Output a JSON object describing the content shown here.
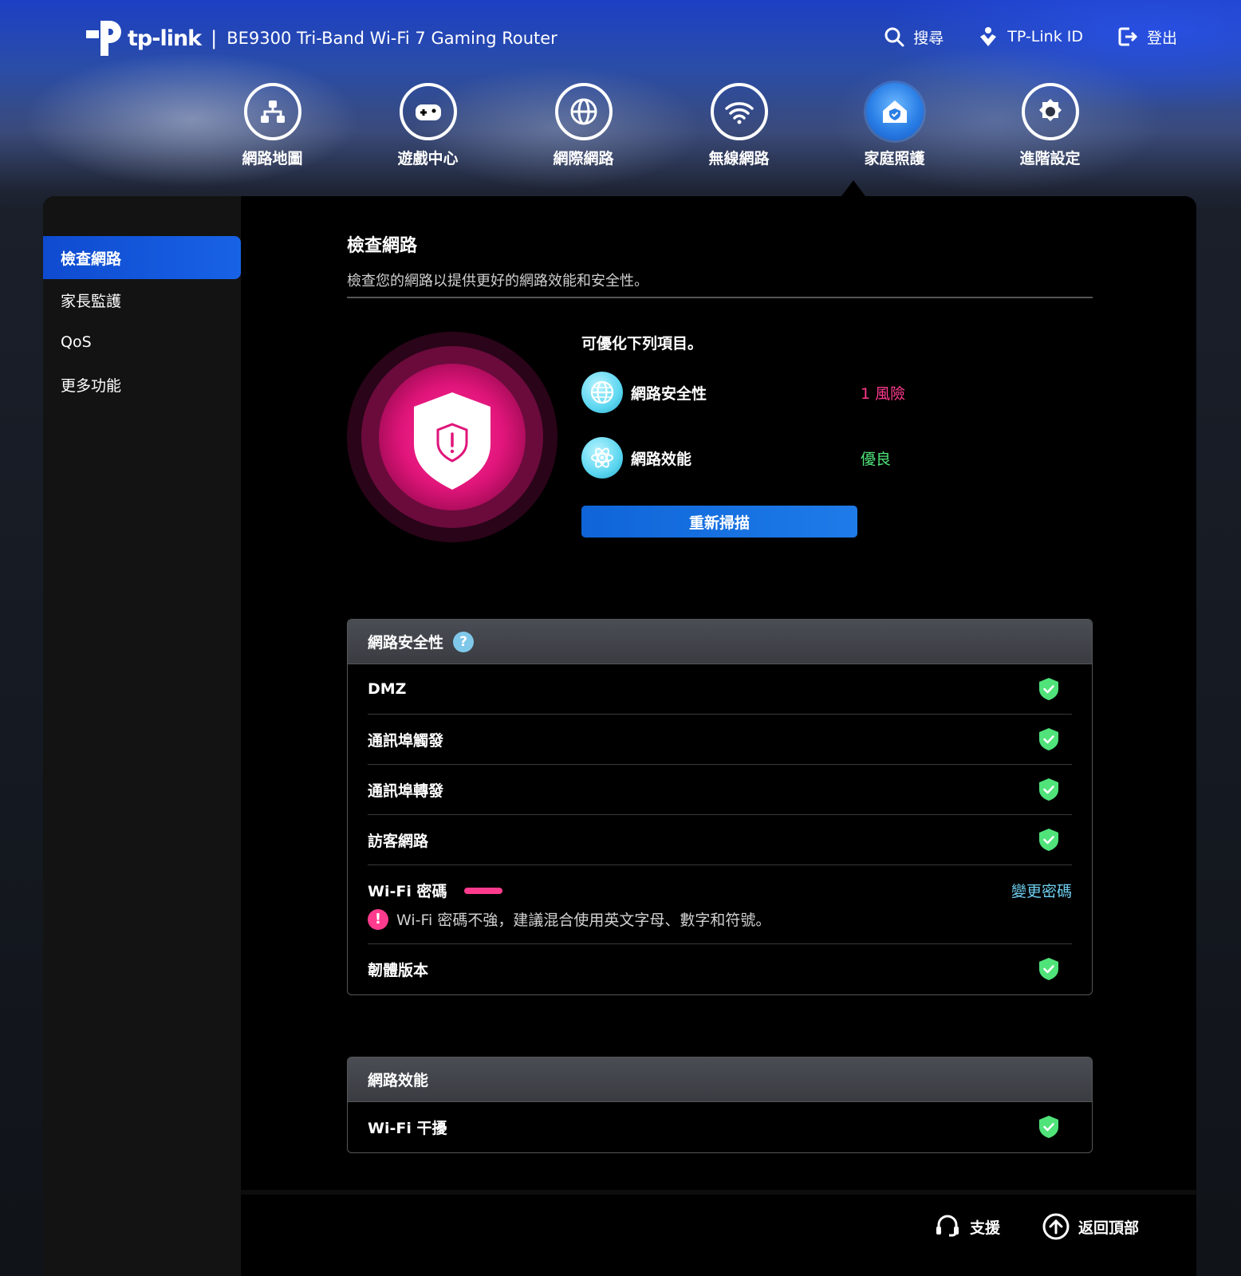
{
  "header": {
    "brand": "tp-link",
    "separator": "|",
    "product": "BE9300 Tri-Band Wi-Fi 7 Gaming Router",
    "actions": [
      {
        "label": "搜尋",
        "icon": "search-icon"
      },
      {
        "label": "TP-Link ID",
        "icon": "tplink-id-icon"
      },
      {
        "label": "登出",
        "icon": "logout-icon"
      }
    ]
  },
  "nav": {
    "items": [
      {
        "label": "網路地圖",
        "icon": "network-map-icon"
      },
      {
        "label": "遊戲中心",
        "icon": "gamepad-icon"
      },
      {
        "label": "網際網路",
        "icon": "globe-icon"
      },
      {
        "label": "無線網路",
        "icon": "wifi-icon"
      },
      {
        "label": "家庭照護",
        "icon": "home-care-icon"
      },
      {
        "label": "進階設定",
        "icon": "gear-icon"
      }
    ],
    "active_index": 4
  },
  "sidebar": {
    "items": [
      {
        "label": "檢查網路"
      },
      {
        "label": "家長監護"
      },
      {
        "label": "QoS"
      },
      {
        "label": "更多功能"
      }
    ],
    "active_index": 0
  },
  "main": {
    "title": "檢查網路",
    "description": "檢查您的網路以提供更好的網路效能和安全性。",
    "summary_heading": "可優化下列項目。",
    "summary": [
      {
        "label": "網路安全性",
        "status": "1 風險",
        "icon": "globe-icon",
        "status_color": "#ff3b8e"
      },
      {
        "label": "網路效能",
        "status": "優良",
        "icon": "atom-icon",
        "status_color": "#4fe37a"
      }
    ],
    "rescan_label": "重新掃描"
  },
  "security_card": {
    "title": "網路安全性",
    "help": "?",
    "rows": [
      {
        "label": "DMZ"
      },
      {
        "label": "通訊埠觸發"
      },
      {
        "label": "通訊埠轉發"
      },
      {
        "label": "訪客網路"
      },
      {
        "label": "Wi-Fi 密碼",
        "action": "變更密碼",
        "warning": "Wi-Fi 密碼不強，建議混合使用英文字母、數字和符號。",
        "warn_symbol": "!"
      },
      {
        "label": "韌體版本"
      }
    ]
  },
  "performance_card": {
    "title": "網路效能",
    "rows": [
      {
        "label": "Wi-Fi 干擾"
      }
    ]
  },
  "footer": {
    "links": [
      {
        "label": "支援",
        "icon": "headset-icon"
      },
      {
        "label": "返回頂部",
        "icon": "back-to-top-icon"
      }
    ]
  },
  "colors": {
    "accent_blue": "#1862e6",
    "risk": "#ff3b8e",
    "good": "#4fe37a",
    "ok_shield": "#4fe37a",
    "link": "#6fcff0"
  }
}
